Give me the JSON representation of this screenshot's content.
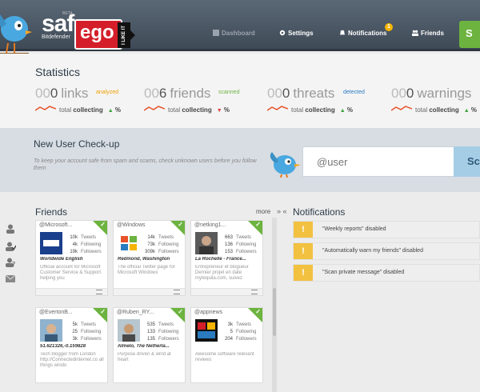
{
  "header": {
    "brand": {
      "beta": "BETA",
      "name": "saf",
      "sub": "Bitdefender",
      "ego": "ego",
      "like": "I LIKE IT"
    },
    "nav": [
      {
        "label": "Dashboard",
        "icon": "dashboard-icon"
      },
      {
        "label": "Settings",
        "icon": "gear-icon"
      },
      {
        "label": "Notifications",
        "icon": "bell-icon",
        "badge": "1"
      },
      {
        "label": "Friends",
        "icon": "people-icon"
      }
    ],
    "cta_label": "S"
  },
  "statistics": {
    "title": "Statistics",
    "items": [
      {
        "num_prefix": "00",
        "num_value": "0",
        "label": "links",
        "sub": "analyzed",
        "sub_color": "#f0a000",
        "total": "total",
        "status": "collecting",
        "trend": "▲",
        "trend_color": "#3aa33a",
        "pct": "%"
      },
      {
        "num_prefix": "00",
        "num_value": "6",
        "label": "friends",
        "sub": "scanned",
        "sub_color": "#6cb33f",
        "total": "total",
        "status": "collecting",
        "trend": "▼",
        "trend_color": "#d8403a",
        "pct": "%"
      },
      {
        "num_prefix": "00",
        "num_value": "0",
        "label": "threats",
        "sub": "detected",
        "sub_color": "#2a7bbf",
        "total": "total",
        "status": "collecting",
        "trend": "▲",
        "trend_color": "#3aa33a",
        "pct": "%"
      },
      {
        "num_prefix": "00",
        "num_value": "0",
        "label": "warnings",
        "sub": "",
        "sub_color": "#999999",
        "total": "total",
        "status": "collecting",
        "trend": "▲",
        "trend_color": "#3aa33a",
        "pct": "%"
      }
    ]
  },
  "checkup": {
    "title": "New User Check-up",
    "description": "To keep your account safe from spam and scams, check unknown users before you follow them",
    "placeholder": "@user",
    "button": "Sc"
  },
  "friends": {
    "title": "Friends",
    "more": "more",
    "arrow_right": "»",
    "arrow_left": "«",
    "cards": [
      {
        "handle": "@Microsoft...",
        "avatar": "microsoft-logo",
        "tweets": "10k",
        "following": "4k",
        "followers": "19k",
        "location": "Worldwide English",
        "bio": "Official account for Microsoft Customer Service & Support helping you"
      },
      {
        "handle": "@Windows",
        "avatar": "windows-logo",
        "tweets": "14k",
        "following": "73k",
        "followers": "309k",
        "location": "Redmond, Washington",
        "bio": "The official Twitter page for Microsoft Windows"
      },
      {
        "handle": "@netking1...",
        "avatar": "person-photo",
        "tweets": "663",
        "following": "136",
        "followers": "153",
        "location": "La Rochelle - France...",
        "bio": "Entrepreneur et blogueur Dernier projet en date mytequila.com, suivez"
      },
      {
        "handle": "@EvertonB...",
        "avatar": "avatar-photo",
        "tweets": "5k",
        "following": "25",
        "followers": "3k",
        "location": "51.621326,-0.159828",
        "bio": "Tech blogger from London http://Connectedinternet.co all things windo"
      },
      {
        "handle": "@Ruben_RY...",
        "avatar": "avatar-photo",
        "tweets": "535",
        "following": "133",
        "followers": "135",
        "location": "Almelo, The Netherla...",
        "bio": "Purpose driven & wind at heart"
      },
      {
        "handle": "@appnews",
        "avatar": "app-news-logo",
        "tweets": "3k",
        "following": "5",
        "followers": "204",
        "location": "",
        "bio": "Awesome software relevant reviews"
      }
    ],
    "count_labels": {
      "tweets": "Tweets",
      "following": "Following",
      "followers": "Followers"
    }
  },
  "notifications": {
    "title": "Notifications",
    "items": [
      {
        "text": "\"Weekly reports\" disabled"
      },
      {
        "text": "\"Automatically warn my friends\" disabled"
      },
      {
        "text": "\"Scan private message\" disabled"
      }
    ]
  },
  "colors": {
    "accent_green": "#6cb33f",
    "warn_yellow": "#f2c140",
    "header_dark": "#3f4a56"
  }
}
